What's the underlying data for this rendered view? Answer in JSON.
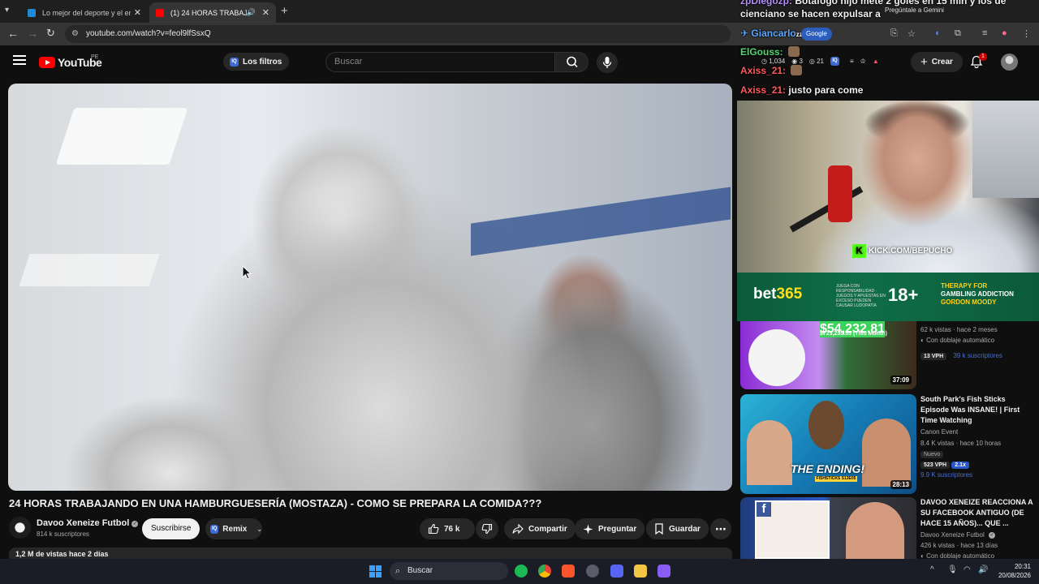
{
  "browser": {
    "tabs": [
      {
        "title": "Lo mejor del deporte y el entre"
      },
      {
        "title": "(1) 24 HORAS TRABAJANDO",
        "active": true
      }
    ],
    "url": "youtube.com/watch?v=feol9lfSsxQ"
  },
  "masthead": {
    "logo_text": "YouTube",
    "country": "PE",
    "filters_label": "Los filtros",
    "filters_badge": "IQ",
    "search_placeholder": "Buscar",
    "stats": [
      "1,034",
      "3",
      "21"
    ],
    "create_label": "Crear",
    "notifications_count": "1"
  },
  "video": {
    "title": "24 HORAS TRABAJANDO EN UNA HAMBURGUESERÍA (MOSTAZA) - COMO SE PREPARA LA COMIDA???",
    "channel": "Davoo Xeneize Futbol",
    "subscribers": "814 k suscriptores",
    "subscribe_label": "Suscribirse",
    "remix_label": "Remix",
    "likes": "76 k",
    "share_label": "Compartir",
    "ask_label": "Preguntar",
    "save_label": "Guardar",
    "views_line": "1,2 M de vistas  hace 2 días"
  },
  "overlay": {
    "chat": [
      {
        "user": "zpDiegozp:",
        "text": "Botafogo hijo mete 2 goles en 15 min y los de"
      },
      {
        "user": "",
        "text": "cienciano se hacen expulsar a"
      },
      {
        "user": "Giancarlo",
        "text": "zzzsg"
      },
      {
        "user": "ElGouss:",
        "text": ""
      },
      {
        "user": "Axiss_21:",
        "text": ""
      },
      {
        "user": "Axiss_21:",
        "text": "justo para come"
      }
    ],
    "gemini_hint": "Pregúntale a Gemini",
    "google_chip": "Google",
    "kick_url": "KICK.COM/BEPUCHO",
    "bet_brand": "bet",
    "bet_brand_num": "365",
    "bet_small": "JUEGA CON RESPONSABILIDAD · JUEGOS Y APUESTAS EN EXCESO PUEDEN CAUSAR LUDOPATÍA",
    "bet_age": "18+",
    "bet_right_1": "THERAPY FOR",
    "bet_right_2": "GAMBLING ADDICTION",
    "bet_right_3": "GORDON MOODY"
  },
  "related": [
    {
      "title": "",
      "views": "62 k vistas · hace 2 meses",
      "dubbed": "Con doblaje automático",
      "vph": "13 VPH",
      "subs": "39 k suscriptores",
      "duration": "37:09",
      "thumb_text": "$54,232.81",
      "thumb_sub": "$723,235.55 (This Month)"
    },
    {
      "title": "South Park's Fish Sticks Episode Was INSANE! | First Time Watching",
      "channel": "Canon Event",
      "views": "8.4 K vistas · hace 10 horas",
      "badge": "Nuevo",
      "vph": "523 VPH",
      "ratio": "2.1x",
      "subs": "9.9 K suscriptores",
      "duration": "28:13",
      "thumb_text": "THE ENDING!",
      "thumb_sub": "FISHSTICKS S13E05"
    },
    {
      "title": "DAVOO XENEIZE REACCIONA A SU FACEBOOK ANTIGUO (DE HACE 15 AÑOS)... QUE ...",
      "channel": "Davoo Xeneize Futbol",
      "views": "426 k vistas · hace 13 días",
      "dubbed": "Con doblaje automático"
    }
  ],
  "taskbar": {
    "search_label": "Buscar",
    "time": "20:31",
    "date": "20/08/2026"
  }
}
